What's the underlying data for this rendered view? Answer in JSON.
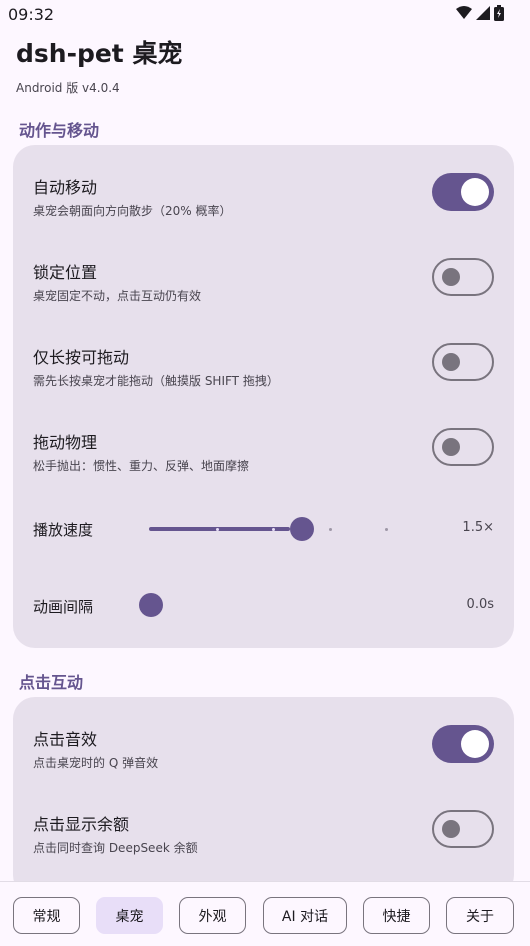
{
  "status_bar": {
    "time": "09:32",
    "icons": [
      "wifi-icon",
      "signal-icon",
      "battery-icon"
    ]
  },
  "app": {
    "title": "dsh-pet 桌宠",
    "version": "Android 版 v4.0.4"
  },
  "sections": {
    "motion": {
      "title": "动作与移动",
      "items": [
        {
          "title": "自动移动",
          "subtitle": "桌宠会朝面向方向散步（20% 概率）",
          "enabled": true
        },
        {
          "title": "锁定位置",
          "subtitle": "桌宠固定不动，点击互动仍有效",
          "enabled": false
        },
        {
          "title": "仅长按可拖动",
          "subtitle": "需先长按桌宠才能拖动（触摸版 SHIFT 拖拽）",
          "enabled": false
        },
        {
          "title": "拖动物理",
          "subtitle": "松手抛出：惯性、重力、反弹、地面摩擦",
          "enabled": false
        }
      ],
      "speed": {
        "label": "播放速度",
        "value": "1.5×",
        "level": 1.5,
        "min": 0.5,
        "max": 2.5,
        "steps": 5
      },
      "interval": {
        "label": "动画间隔",
        "value": "0.0s",
        "level": 0
      }
    },
    "click": {
      "title": "点击互动",
      "items": [
        {
          "title": "点击音效",
          "subtitle": "点击桌宠时的 Q 弹音效",
          "enabled": true
        },
        {
          "title": "点击显示余额",
          "subtitle": "点击同时查询 DeepSeek 余额",
          "enabled": false
        }
      ]
    }
  },
  "nav": {
    "tabs": [
      "常规",
      "桌宠",
      "外观",
      "AI 对话",
      "快捷",
      "关于"
    ],
    "active": "桌宠"
  },
  "colors": {
    "accent": "#65558f",
    "card": "#e7e0ec",
    "background": "#fdf7ff",
    "active_tab": "#e8def8"
  }
}
